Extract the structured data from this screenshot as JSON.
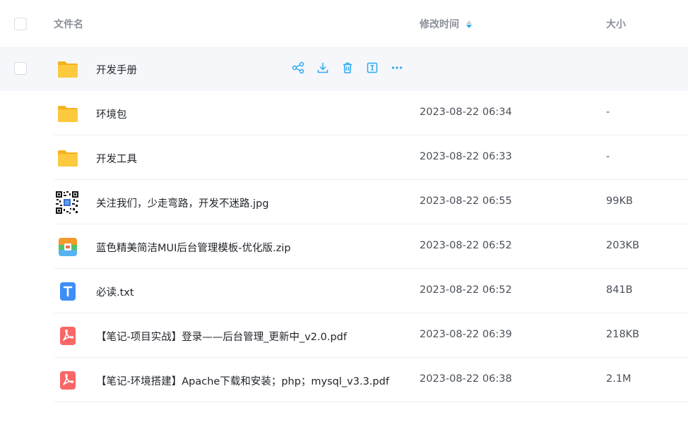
{
  "header": {
    "name_label": "文件名",
    "time_label": "修改时间",
    "size_label": "大小"
  },
  "colors": {
    "accent": "#2ea8f0",
    "folder": "#f9c23c",
    "pdf": "#fa6566",
    "txt": "#3d8ef7",
    "zip_green": "#4cc46b",
    "zip_orange": "#f39a2b"
  },
  "rows": [
    {
      "name": "开发手册",
      "time": "",
      "size": "",
      "icon": "folder-icon",
      "hover": true,
      "actions": [
        "share-icon",
        "download-icon",
        "delete-icon",
        "rename-icon",
        "more-icon"
      ]
    },
    {
      "name": "环境包",
      "time": "2023-08-22 06:34",
      "size": "-",
      "icon": "folder-icon"
    },
    {
      "name": "开发工具",
      "time": "2023-08-22 06:33",
      "size": "-",
      "icon": "folder-icon"
    },
    {
      "name": "关注我们，少走弯路，开发不迷路.jpg",
      "time": "2023-08-22 06:55",
      "size": "99KB",
      "icon": "qr-code-image-icon"
    },
    {
      "name": "蓝色精美简洁MUI后台管理模板-优化版.zip",
      "time": "2023-08-22 06:52",
      "size": "203KB",
      "icon": "zip-archive-icon"
    },
    {
      "name": "必读.txt",
      "time": "2023-08-22 06:52",
      "size": "841B",
      "icon": "text-file-icon"
    },
    {
      "name": "【笔记-项目实战】登录——后台管理_更新中_v2.0.pdf",
      "time": "2023-08-22 06:39",
      "size": "218KB",
      "icon": "pdf-file-icon"
    },
    {
      "name": "【笔记-环境搭建】Apache下载和安装；php；mysql_v3.3.pdf",
      "time": "2023-08-22 06:38",
      "size": "2.1M",
      "icon": "pdf-file-icon"
    }
  ]
}
